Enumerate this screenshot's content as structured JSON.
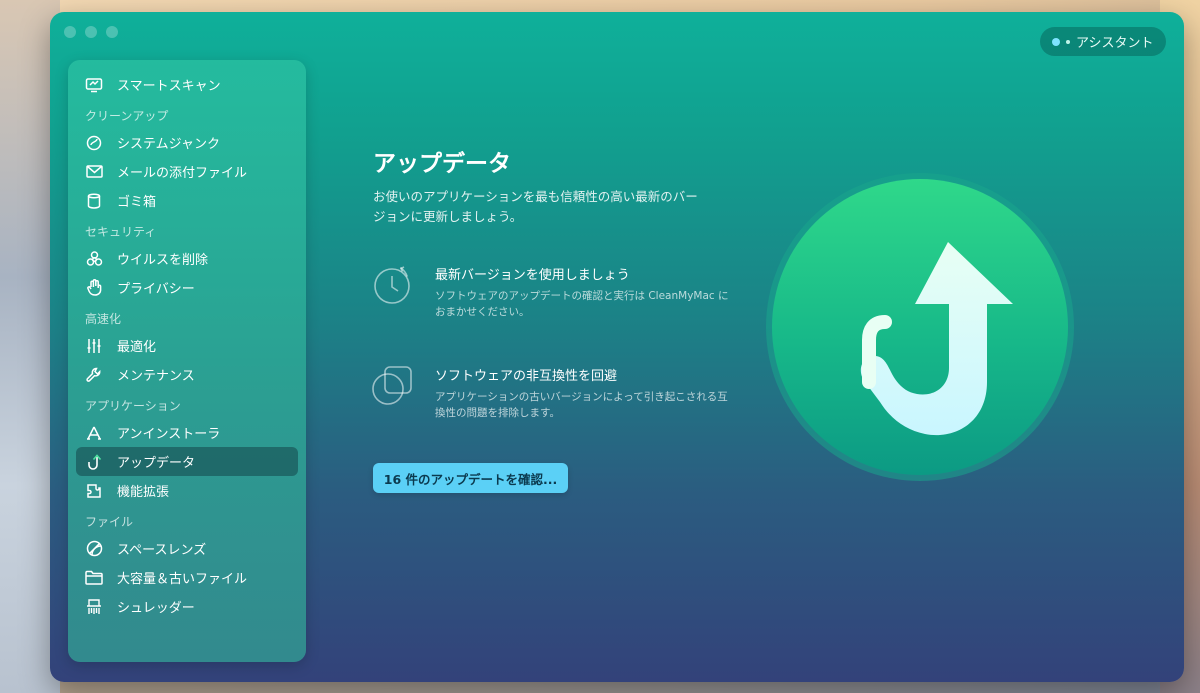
{
  "window": {
    "assistant_label": "アシスタント"
  },
  "sidebar": {
    "top_item": {
      "label": "スマートスキャン",
      "icon": "smart-scan-icon"
    },
    "sections": [
      {
        "label": "クリーンアップ",
        "items": [
          {
            "label": "システムジャンク",
            "icon": "system-junk-icon"
          },
          {
            "label": "メールの添付ファイル",
            "icon": "mail-icon"
          },
          {
            "label": "ゴミ箱",
            "icon": "trash-icon"
          }
        ]
      },
      {
        "label": "セキュリティ",
        "items": [
          {
            "label": "ウイルスを削除",
            "icon": "biohazard-icon"
          },
          {
            "label": "プライバシー",
            "icon": "hand-icon"
          }
        ]
      },
      {
        "label": "高速化",
        "items": [
          {
            "label": "最適化",
            "icon": "sliders-icon"
          },
          {
            "label": "メンテナンス",
            "icon": "wrench-icon"
          }
        ]
      },
      {
        "label": "アプリケーション",
        "items": [
          {
            "label": "アンインストーラ",
            "icon": "app-store-icon"
          },
          {
            "label": "アップデータ",
            "icon": "updater-icon",
            "active": true
          },
          {
            "label": "機能拡張",
            "icon": "extensions-icon"
          }
        ]
      },
      {
        "label": "ファイル",
        "items": [
          {
            "label": "スペースレンズ",
            "icon": "space-lens-icon"
          },
          {
            "label": "大容量＆古いファイル",
            "icon": "folder-icon"
          },
          {
            "label": "シュレッダー",
            "icon": "shredder-icon"
          }
        ]
      }
    ]
  },
  "main": {
    "title": "アップデータ",
    "subtitle": "お使いのアプリケーションを最も信頼性の高い最新のバージョンに更新しましょう。",
    "features": [
      {
        "title": "最新バージョンを使用しましょう",
        "description": "ソフトウェアのアップデートの確認と実行は CleanMyMac におまかせください。",
        "icon": "clock-refresh-icon"
      },
      {
        "title": "ソフトウェアの非互換性を回避",
        "description": "アプリケーションの古いバージョンによって引き起こされる互換性の問題を排除します。",
        "icon": "overlap-shapes-icon"
      }
    ],
    "cta_label": "16 件のアップデートを確認...",
    "hero_icon": "updater-arrow-icon"
  }
}
